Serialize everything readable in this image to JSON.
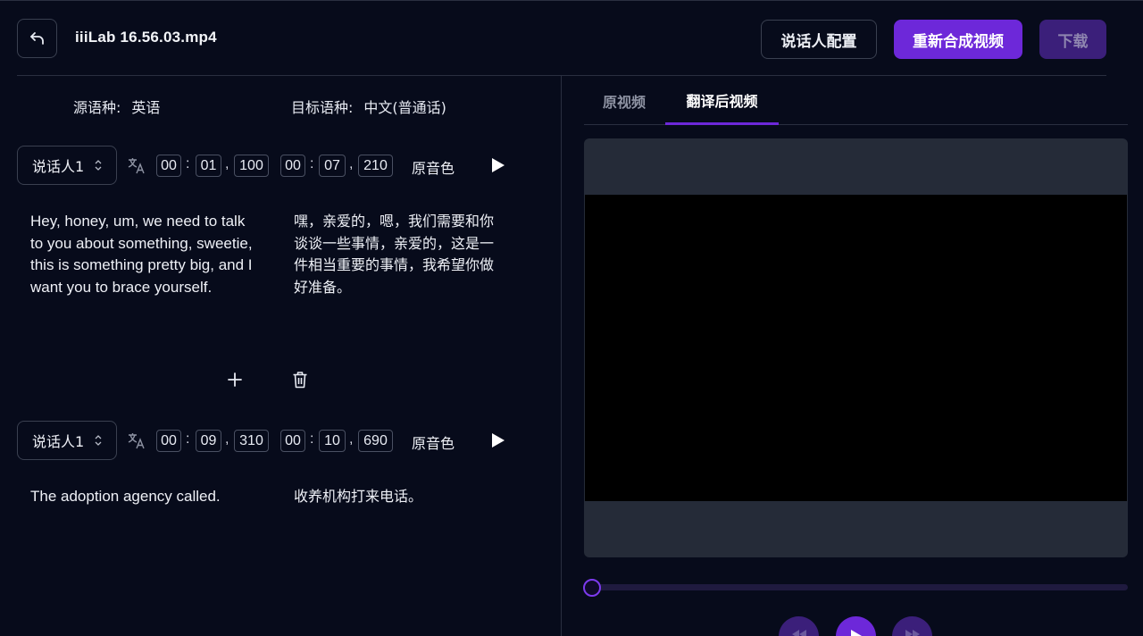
{
  "header": {
    "file_name": "iiiLab 16.56.03.mp4",
    "speaker_config_label": "说话人配置",
    "resynthesize_label": "重新合成视频",
    "download_label": "下载"
  },
  "languages": {
    "source_label": "源语种:",
    "source_value": "英语",
    "target_label": "目标语种:",
    "target_value": "中文(普通话)"
  },
  "segments": [
    {
      "speaker": "说话人1",
      "start": {
        "hh": "00",
        "mm": "01",
        "ms": "100"
      },
      "end": {
        "hh": "00",
        "mm": "07",
        "ms": "210"
      },
      "voice": "原音色",
      "source_text": "Hey, honey, um, we need to talk to you about something, sweetie, this is something pretty big, and I want you to brace yourself.",
      "target_text": "嘿，亲爱的，嗯，我们需要和你谈谈一些事情，亲爱的，这是一件相当重要的事情，我希望你做好准备。"
    },
    {
      "speaker": "说话人1",
      "start": {
        "hh": "00",
        "mm": "09",
        "ms": "310"
      },
      "end": {
        "hh": "00",
        "mm": "10",
        "ms": "690"
      },
      "voice": "原音色",
      "source_text": "The adoption agency called.",
      "target_text": "收养机构打来电话。"
    }
  ],
  "separators": {
    "colon": ":",
    "comma": ","
  },
  "tabs": [
    {
      "label": "原视频",
      "active": false
    },
    {
      "label": "翻译后视频",
      "active": true
    }
  ],
  "player": {
    "progress_fraction": 0
  },
  "icons": [
    "back-arrow-icon",
    "chevron-updown-icon",
    "translate-icon",
    "play-icon",
    "plus-icon",
    "trash-icon",
    "rewind-icon",
    "fast-forward-icon"
  ],
  "colors": {
    "accent": "#6d28d9",
    "background": "#070b1b",
    "panel": "#252b38"
  }
}
